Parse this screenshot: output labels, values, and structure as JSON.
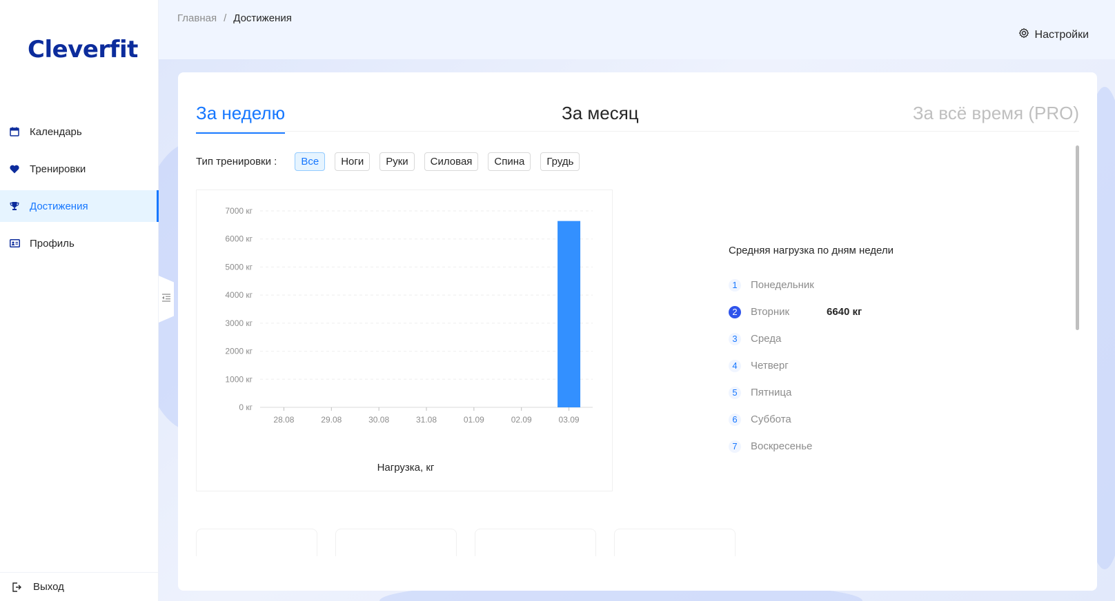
{
  "app": {
    "logo_text": "Cleverfit"
  },
  "sidebar": {
    "items": [
      {
        "label": "Календарь",
        "icon": "calendar-icon",
        "active": false
      },
      {
        "label": "Тренировки",
        "icon": "heart-icon",
        "active": false
      },
      {
        "label": "Достижения",
        "icon": "trophy-icon",
        "active": true
      },
      {
        "label": "Профиль",
        "icon": "id-card-icon",
        "active": false
      }
    ],
    "logout_label": "Выход"
  },
  "header": {
    "breadcrumb": {
      "home": "Главная",
      "separator": "/",
      "current": "Достижения"
    },
    "settings_label": "Настройки"
  },
  "tabs": [
    {
      "label": "За неделю",
      "active": true
    },
    {
      "label": "За месяц",
      "active": false
    },
    {
      "label": "За всё время (PRO)",
      "active": false,
      "disabled": true
    }
  ],
  "filter": {
    "label": "Тип тренировки :",
    "options": [
      "Все",
      "Ноги",
      "Руки",
      "Силовая",
      "Спина",
      "Грудь"
    ],
    "selected": "Все"
  },
  "chart_data": {
    "type": "bar",
    "categories": [
      "28.08",
      "29.08",
      "30.08",
      "31.08",
      "01.09",
      "02.09",
      "03.09"
    ],
    "values": [
      0,
      0,
      0,
      0,
      0,
      0,
      6640
    ],
    "yticks": [
      "0 кг",
      "1000 кг",
      "2000 кг",
      "3000 кг",
      "4000 кг",
      "5000 кг",
      "6000 кг",
      "7000 кг"
    ],
    "ylim": [
      0,
      7000
    ],
    "xlabel": "Нагрузка, кг",
    "ylabel": "",
    "bar_color": "#3390ff",
    "grid": true
  },
  "stats": {
    "title": "Средняя нагрузка по дням недели",
    "days": [
      {
        "n": "1",
        "name": "Понедельник",
        "value": ""
      },
      {
        "n": "2",
        "name": "Вторник",
        "value": "6640 кг"
      },
      {
        "n": "3",
        "name": "Среда",
        "value": ""
      },
      {
        "n": "4",
        "name": "Четверг",
        "value": ""
      },
      {
        "n": "5",
        "name": "Пятница",
        "value": ""
      },
      {
        "n": "6",
        "name": "Суббота",
        "value": ""
      },
      {
        "n": "7",
        "name": "Воскресенье",
        "value": ""
      }
    ]
  },
  "colors": {
    "accent": "#1677ff",
    "brand": "#0c2c9c",
    "active_bg": "#e6f4ff"
  }
}
